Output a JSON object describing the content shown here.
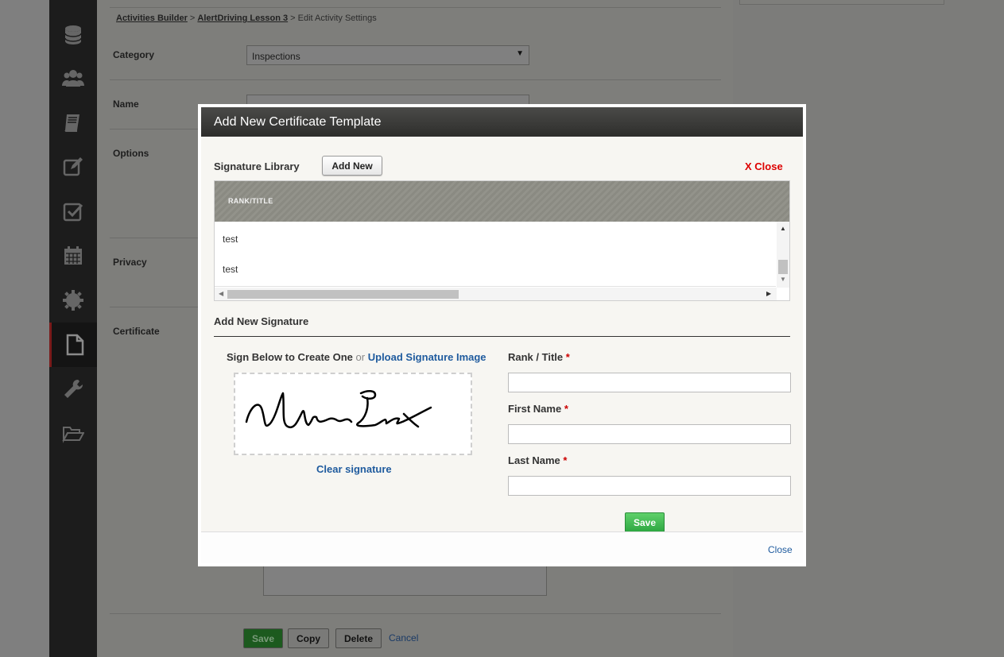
{
  "breadcrumb": {
    "item1": "Activities Builder",
    "sep1": " > ",
    "item2": "AlertDriving Lesson 3",
    "sep2": " > ",
    "item3": "Edit Activity Settings"
  },
  "form": {
    "category_label": "Category",
    "category_value": "Inspections",
    "name_label": "Name",
    "options_label": "Options",
    "privacy_label": "Privacy",
    "certificate_label": "Certificate"
  },
  "page_buttons": {
    "save": "Save",
    "copy": "Copy",
    "delete": "Delete",
    "cancel": "Cancel"
  },
  "sidebar": {
    "items": [
      {
        "icon": "database-icon"
      },
      {
        "icon": "users-icon"
      },
      {
        "icon": "book-icon"
      },
      {
        "icon": "edit-icon"
      },
      {
        "icon": "checkbox-icon"
      },
      {
        "icon": "calendar-icon"
      },
      {
        "icon": "gear-icon"
      },
      {
        "icon": "file-icon",
        "active": true
      },
      {
        "icon": "wrench-icon"
      },
      {
        "icon": "folder-open-icon"
      }
    ]
  },
  "modal": {
    "title": "Add New Certificate Template",
    "signature_library_label": "Signature Library",
    "add_new_label": "Add New",
    "close_x_label": "X Close",
    "grid": {
      "column_header": "RANK/TITLE",
      "rows": [
        "test",
        "test"
      ]
    },
    "add_signature_title": "Add New Signature",
    "sign_below": "Sign Below to Create One",
    "or": "or",
    "upload_link": "Upload Signature Image",
    "clear_signature": "Clear signature",
    "fields": {
      "rank_title": "Rank / Title",
      "first_name": "First Name",
      "last_name": "Last Name",
      "required_mark": "*"
    },
    "save_label": "Save",
    "footer_close": "Close"
  },
  "colors": {
    "accent_link": "#1f5b9e",
    "save_green": "#2ea842",
    "close_red": "#dd0000"
  }
}
